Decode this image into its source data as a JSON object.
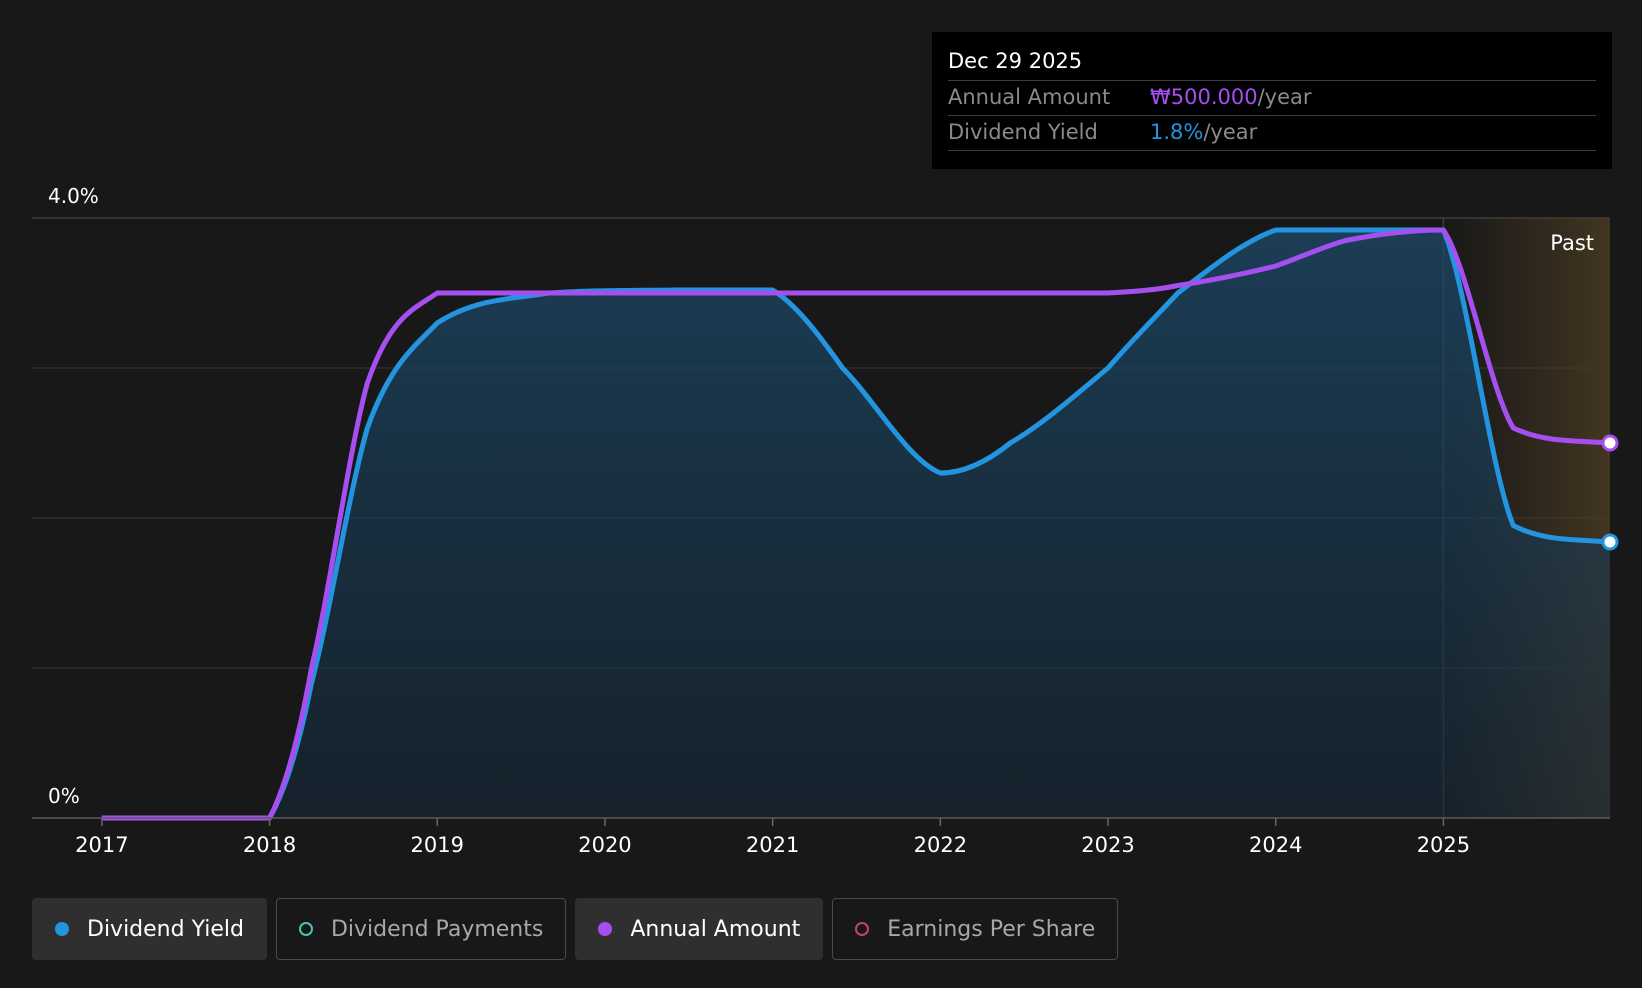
{
  "tooltip": {
    "date": "Dec 29 2025",
    "annual_label": "Annual Amount",
    "annual_value": "₩500.000",
    "annual_suffix": "/year",
    "yield_label": "Dividend Yield",
    "yield_value": "1.8%",
    "yield_suffix": "/year"
  },
  "past_label": "Past",
  "legend": [
    {
      "label": "Dividend Yield",
      "color": "#2394df",
      "active": true
    },
    {
      "label": "Dividend Payments",
      "color": "#4fc2b6",
      "active": false
    },
    {
      "label": "Annual Amount",
      "color": "#a64ff0",
      "active": true
    },
    {
      "label": "Earnings Per Share",
      "color": "#c0427d",
      "active": false
    }
  ],
  "colors": {
    "yield": "#2394df",
    "annual": "#a64ff0",
    "background": "#181818",
    "grid": "#333333",
    "future_band": "#4a3a22"
  },
  "chart_data": {
    "type": "line",
    "y_tick_labels": [
      "4.0%",
      "0%"
    ],
    "ylim": [
      0,
      4.0
    ],
    "x_tick_labels": [
      "2017",
      "2018",
      "2019",
      "2020",
      "2021",
      "2022",
      "2023",
      "2024",
      "2025"
    ],
    "xlim": [
      "2016-08",
      "2025-12-29"
    ],
    "grid": true,
    "past_start": "2025-01",
    "series": [
      {
        "name": "Dividend Yield",
        "unit": "%",
        "points": [
          [
            "2017-01",
            0
          ],
          [
            "2018-01",
            0
          ],
          [
            "2018-04",
            0.9
          ],
          [
            "2018-08",
            2.6
          ],
          [
            "2019-01",
            3.3
          ],
          [
            "2019-09",
            3.5
          ],
          [
            "2020-06",
            3.52
          ],
          [
            "2021-01",
            3.52
          ],
          [
            "2021-06",
            3.0
          ],
          [
            "2022-01",
            2.3
          ],
          [
            "2022-06",
            2.5
          ],
          [
            "2023-01",
            3.0
          ],
          [
            "2023-06",
            3.5
          ],
          [
            "2024-01",
            3.92
          ],
          [
            "2025-01",
            3.92
          ],
          [
            "2025-06",
            1.95
          ],
          [
            "2025-12-29",
            1.84
          ]
        ]
      },
      {
        "name": "Annual Amount",
        "unit": "KRW",
        "points": [
          [
            "2017-01",
            0
          ],
          [
            "2018-01",
            0
          ],
          [
            "2018-04",
            1.0
          ],
          [
            "2018-08",
            2.9
          ],
          [
            "2019-01",
            3.5
          ],
          [
            "2020-01",
            3.5
          ],
          [
            "2021-01",
            3.5
          ],
          [
            "2022-01",
            3.5
          ],
          [
            "2023-01",
            3.5
          ],
          [
            "2023-06",
            3.55
          ],
          [
            "2024-01",
            3.68
          ],
          [
            "2024-06",
            3.85
          ],
          [
            "2025-01",
            3.92
          ],
          [
            "2025-06",
            2.6
          ],
          [
            "2025-12-29",
            2.5
          ]
        ]
      }
    ]
  }
}
